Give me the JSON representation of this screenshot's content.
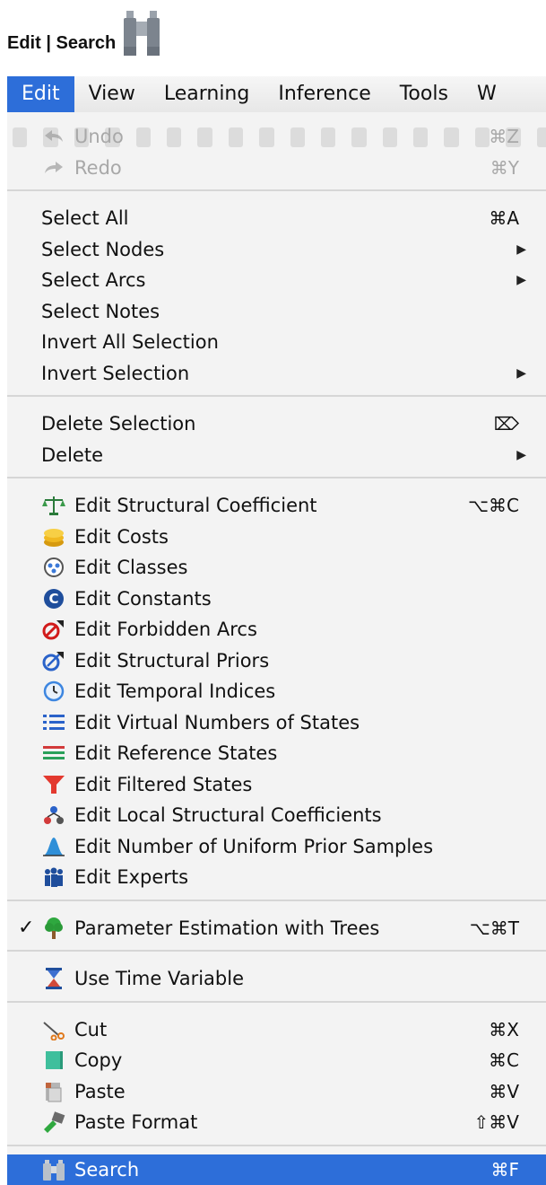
{
  "header": {
    "title": "Edit | Search",
    "icon": "binoculars-icon"
  },
  "menubar": {
    "items": [
      {
        "label": "Edit",
        "active": true
      },
      {
        "label": "View"
      },
      {
        "label": "Learning"
      },
      {
        "label": "Inference"
      },
      {
        "label": "Tools"
      },
      {
        "label": "W"
      }
    ]
  },
  "menu": {
    "groups": [
      [
        {
          "label": "Undo",
          "shortcut": "⌘Z",
          "icon": "undo-icon",
          "disabled": true
        },
        {
          "label": "Redo",
          "shortcut": "⌘Y",
          "icon": "redo-icon",
          "disabled": true
        }
      ],
      [
        {
          "label": "Select All",
          "shortcut": "⌘A"
        },
        {
          "label": "Select Nodes",
          "submenu": true
        },
        {
          "label": "Select Arcs",
          "submenu": true
        },
        {
          "label": "Select Notes"
        },
        {
          "label": "Invert All Selection"
        },
        {
          "label": "Invert Selection",
          "submenu": true
        }
      ],
      [
        {
          "label": "Delete Selection",
          "shortcut": "⌦"
        },
        {
          "label": "Delete",
          "submenu": true
        }
      ],
      [
        {
          "label": "Edit Structural Coefficient",
          "shortcut": "⌥⌘C",
          "icon": "scale-icon"
        },
        {
          "label": "Edit Costs",
          "icon": "coins-icon"
        },
        {
          "label": "Edit Classes",
          "icon": "classes-icon"
        },
        {
          "label": "Edit Constants",
          "icon": "constant-c-icon"
        },
        {
          "label": "Edit Forbidden Arcs",
          "icon": "forbidden-arc-icon"
        },
        {
          "label": "Edit Structural Priors",
          "icon": "prior-arc-icon"
        },
        {
          "label": "Edit Temporal Indices",
          "icon": "clock-icon"
        },
        {
          "label": "Edit Virtual Numbers of States",
          "icon": "numbered-list-icon"
        },
        {
          "label": "Edit Reference States",
          "icon": "reference-lines-icon"
        },
        {
          "label": "Edit Filtered States",
          "icon": "filter-icon"
        },
        {
          "label": "Edit Local Structural Coefficients",
          "icon": "local-structure-icon"
        },
        {
          "label": "Edit Number of Uniform Prior Samples",
          "icon": "bell-curve-icon"
        },
        {
          "label": "Edit Experts",
          "icon": "experts-icon"
        }
      ],
      [
        {
          "label": "Parameter Estimation with Trees",
          "shortcut": "⌥⌘T",
          "icon": "tree-icon",
          "checked": true,
          "check_mark": "✓"
        }
      ],
      [
        {
          "label": "Use Time Variable",
          "icon": "hourglass-icon"
        }
      ],
      [
        {
          "label": "Cut",
          "shortcut": "⌘X",
          "icon": "scissors-icon"
        },
        {
          "label": "Copy",
          "shortcut": "⌘C",
          "icon": "copy-icon"
        },
        {
          "label": "Paste",
          "shortcut": "⌘V",
          "icon": "paste-icon"
        },
        {
          "label": "Paste Format",
          "shortcut": "⇧⌘V",
          "icon": "paste-format-icon"
        }
      ],
      [
        {
          "label": "Search",
          "shortcut": "⌘F",
          "icon": "binoculars-icon",
          "selected": true
        }
      ]
    ]
  },
  "submenu_arrow": "▶",
  "colors": {
    "selection": "#2d6ed9",
    "menu_bg": "#f3f3f3",
    "disabled_text": "#a8a8a8"
  }
}
